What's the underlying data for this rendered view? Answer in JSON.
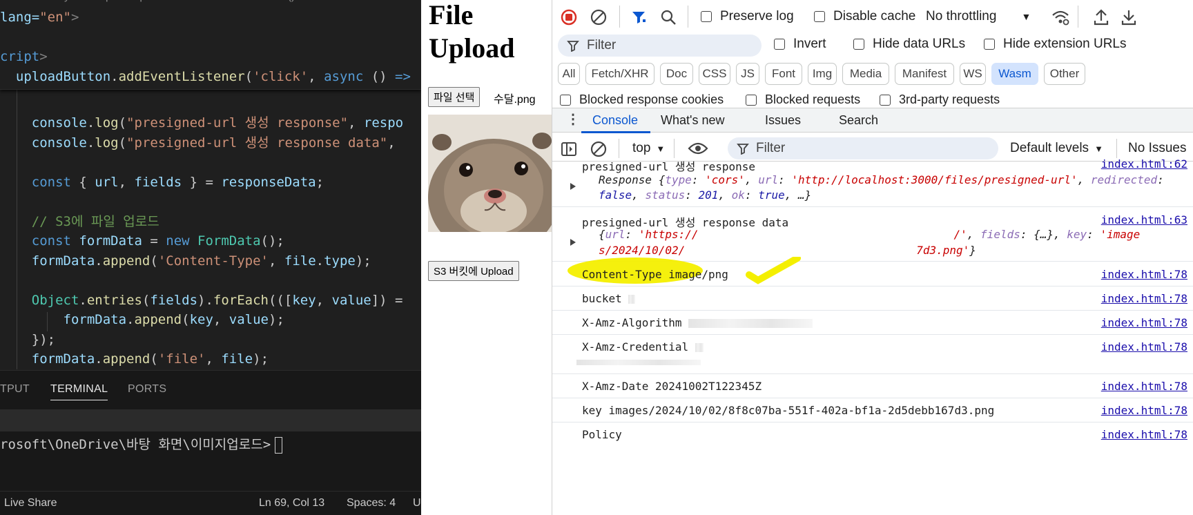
{
  "vscode": {
    "sticky_lines": [
      {
        "parts": [
          {
            "t": "lang=",
            "c": "attr"
          },
          {
            "t": "\"en\"",
            "c": "str"
          },
          {
            "t": ">",
            "c": "punc"
          }
        ]
      },
      {
        "parts": [
          {
            "t": "",
            "c": ""
          }
        ]
      },
      {
        "parts": [
          {
            "t": "cript",
            "c": "tag"
          },
          {
            "t": ">",
            "c": "punc"
          }
        ]
      },
      {
        "parts": [
          {
            "t": "  uploadButton",
            "c": "var"
          },
          {
            "t": ".",
            "c": ""
          },
          {
            "t": "addEventListener",
            "c": "fn"
          },
          {
            "t": "(",
            "c": ""
          },
          {
            "t": "'click'",
            "c": "str"
          },
          {
            "t": ", ",
            "c": ""
          },
          {
            "t": "async",
            "c": "kw"
          },
          {
            "t": " () ",
            "c": ""
          },
          {
            "t": "=>",
            "c": "kw"
          }
        ]
      }
    ],
    "code_lines": [
      {
        "parts": [
          {
            "t": "    console",
            "c": "var"
          },
          {
            "t": ".",
            "c": ""
          },
          {
            "t": "log",
            "c": "fn"
          },
          {
            "t": "(",
            "c": ""
          },
          {
            "t": "\"presigned-url 생성 response\"",
            "c": "str"
          },
          {
            "t": ", ",
            "c": ""
          },
          {
            "t": "respo",
            "c": "var"
          }
        ]
      },
      {
        "parts": [
          {
            "t": "    console",
            "c": "var"
          },
          {
            "t": ".",
            "c": ""
          },
          {
            "t": "log",
            "c": "fn"
          },
          {
            "t": "(",
            "c": ""
          },
          {
            "t": "\"presigned-url 생성 response data\"",
            "c": "str"
          },
          {
            "t": ",",
            "c": ""
          }
        ]
      },
      {
        "parts": [
          {
            "t": "",
            "c": ""
          }
        ]
      },
      {
        "parts": [
          {
            "t": "    const",
            "c": "kw"
          },
          {
            "t": " { ",
            "c": ""
          },
          {
            "t": "url",
            "c": "var"
          },
          {
            "t": ", ",
            "c": ""
          },
          {
            "t": "fields",
            "c": "var"
          },
          {
            "t": " } = ",
            "c": ""
          },
          {
            "t": "responseData",
            "c": "var"
          },
          {
            "t": ";",
            "c": ""
          }
        ]
      },
      {
        "parts": [
          {
            "t": "",
            "c": ""
          }
        ]
      },
      {
        "parts": [
          {
            "t": "    // S3에 파일 업로드",
            "c": "cm"
          }
        ]
      },
      {
        "parts": [
          {
            "t": "    const",
            "c": "kw"
          },
          {
            "t": " ",
            "c": ""
          },
          {
            "t": "formData",
            "c": "var"
          },
          {
            "t": " = ",
            "c": ""
          },
          {
            "t": "new",
            "c": "kw"
          },
          {
            "t": " ",
            "c": ""
          },
          {
            "t": "FormData",
            "c": "cls"
          },
          {
            "t": "();",
            "c": ""
          }
        ]
      },
      {
        "parts": [
          {
            "t": "    formData",
            "c": "var"
          },
          {
            "t": ".",
            "c": ""
          },
          {
            "t": "append",
            "c": "fn"
          },
          {
            "t": "(",
            "c": ""
          },
          {
            "t": "'Content-Type'",
            "c": "str"
          },
          {
            "t": ", ",
            "c": ""
          },
          {
            "t": "file",
            "c": "var"
          },
          {
            "t": ".",
            "c": ""
          },
          {
            "t": "type",
            "c": "var"
          },
          {
            "t": ");",
            "c": ""
          }
        ]
      },
      {
        "parts": [
          {
            "t": "",
            "c": ""
          }
        ]
      },
      {
        "parts": [
          {
            "t": "    Object",
            "c": "cls"
          },
          {
            "t": ".",
            "c": ""
          },
          {
            "t": "entries",
            "c": "fn"
          },
          {
            "t": "(",
            "c": ""
          },
          {
            "t": "fields",
            "c": "var"
          },
          {
            "t": ").",
            "c": ""
          },
          {
            "t": "forEach",
            "c": "fn"
          },
          {
            "t": "(([",
            "c": ""
          },
          {
            "t": "key",
            "c": "var"
          },
          {
            "t": ", ",
            "c": ""
          },
          {
            "t": "value",
            "c": "var"
          },
          {
            "t": "]) =",
            "c": ""
          }
        ]
      },
      {
        "parts": [
          {
            "t": "        formData",
            "c": "var"
          },
          {
            "t": ".",
            "c": ""
          },
          {
            "t": "append",
            "c": "fn"
          },
          {
            "t": "(",
            "c": ""
          },
          {
            "t": "key",
            "c": "var"
          },
          {
            "t": ", ",
            "c": ""
          },
          {
            "t": "value",
            "c": "var"
          },
          {
            "t": ");",
            "c": ""
          }
        ]
      },
      {
        "parts": [
          {
            "t": "    });",
            "c": ""
          }
        ]
      },
      {
        "parts": [
          {
            "t": "    formData",
            "c": "var"
          },
          {
            "t": ".",
            "c": ""
          },
          {
            "t": "append",
            "c": "fn"
          },
          {
            "t": "(",
            "c": ""
          },
          {
            "t": "'file'",
            "c": "str"
          },
          {
            "t": ", ",
            "c": ""
          },
          {
            "t": "file",
            "c": "var"
          },
          {
            "t": ");",
            "c": ""
          }
        ]
      }
    ],
    "panel_tabs": {
      "output": "TPUT",
      "terminal": "TERMINAL",
      "ports": "PORTS"
    },
    "terminal_prompt": "rosoft\\OneDrive\\바탕 화면\\이미지업로드>",
    "status": {
      "live_share": "Live Share",
      "position": "Ln 69, Col 13",
      "spaces": "Spaces: 4",
      "encoding": "U"
    }
  },
  "webpage": {
    "title": "File Upload",
    "choose_file_label": "파일 선택",
    "file_name": "수달.png",
    "upload_button": "S3 버킷에 Upload"
  },
  "devtools": {
    "toolbar": {
      "preserve_log": "Preserve log",
      "disable_cache": "Disable cache",
      "throttling": "No throttling"
    },
    "filter": {
      "placeholder": "Filter",
      "invert": "Invert",
      "hide_data_urls": "Hide data URLs",
      "hide_extension_urls": "Hide extension URLs"
    },
    "type_chips": [
      "All",
      "Fetch/XHR",
      "Doc",
      "CSS",
      "JS",
      "Font",
      "Img",
      "Media",
      "Manifest",
      "WS",
      "Wasm",
      "Other"
    ],
    "selected_chip": "Wasm",
    "blocked_row": {
      "blocked_cookies": "Blocked response cookies",
      "blocked_requests": "Blocked requests",
      "third_party": "3rd-party requests"
    },
    "drawer_tabs": [
      "Console",
      "What's new",
      "Issues",
      "Search"
    ],
    "console_toolbar": {
      "context": "top",
      "filter_placeholder": "Filter",
      "levels": "Default levels",
      "issues": "No Issues"
    },
    "messages": [
      {
        "text": "presigned-url 생성 response",
        "source": "index.html:62"
      },
      {
        "text": "presigned-url 생성 response data",
        "source": "index.html:63"
      },
      {
        "text": "Content-Type image/png",
        "source": "index.html:78"
      },
      {
        "text": "bucket",
        "source": "index.html:78"
      },
      {
        "text": "X-Amz-Algorithm",
        "source": "index.html:78"
      },
      {
        "text": "X-Amz-Credential",
        "source": "index.html:78"
      },
      {
        "text": "X-Amz-Date 20241002T122345Z",
        "source": "index.html:78"
      },
      {
        "text": "key images/2024/10/02/8f8c07ba-551f-402a-bf1a-2d5debb167d3.png",
        "source": "index.html:78"
      },
      {
        "text": "Policy",
        "source": "index.html:78"
      }
    ],
    "response_obj": {
      "prefix": "Response ",
      "type_key": "type",
      "type_val": "'cors'",
      "url_key": "url",
      "url_val": "'http://localhost:3000/files/presigned-url'",
      "redirected_key": "redirected",
      "redirected_val": "false",
      "status_key": "status",
      "status_val": "201",
      "ok_key": "ok",
      "ok_val": "true",
      "more": "…"
    },
    "data_obj": {
      "url_key": "url",
      "url_val_start": "'https://",
      "url_val_end": "/'",
      "fields_key": "fields",
      "fields_val": "{…}",
      "key_key": "key",
      "key_val_start": "'image",
      "key_val_line2_start": "s/2024/10/02/",
      "key_val_line2_end": "7d3.png'"
    },
    "highlight_color": "#f4ef00",
    "accent_color": "#0b57d0"
  }
}
